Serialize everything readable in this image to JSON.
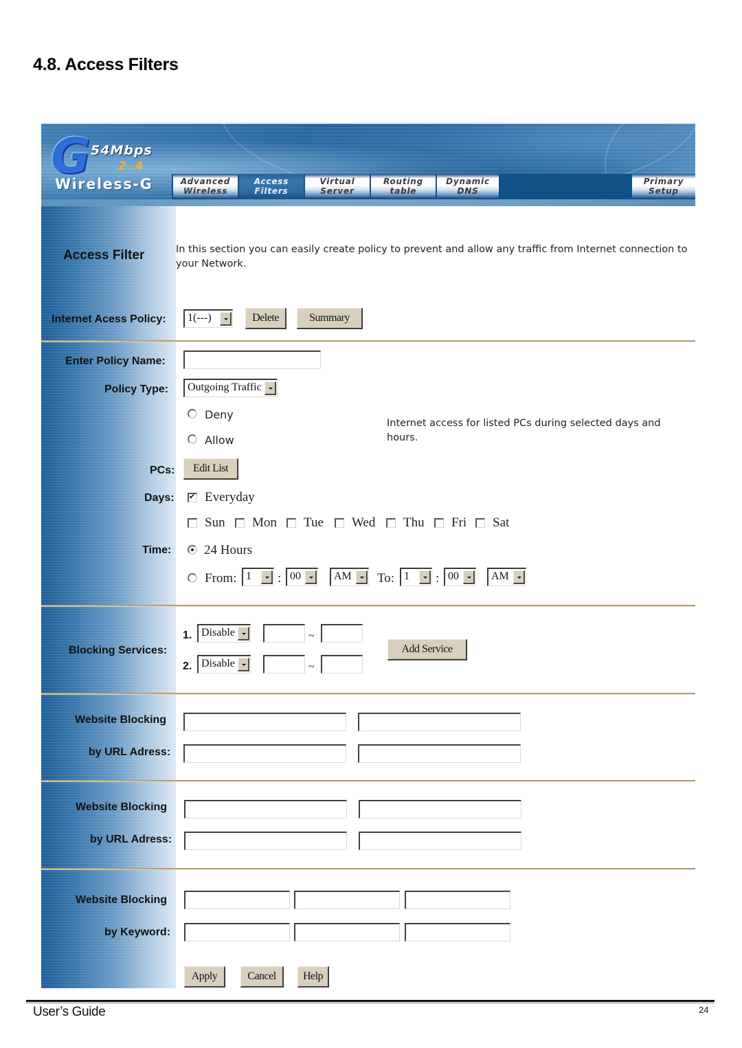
{
  "document": {
    "section_heading": "4.8. Access Filters",
    "footer_left": "User’s Guide",
    "page_number": "24"
  },
  "header": {
    "logo": {
      "letter": "G",
      "speed": "54Mbps",
      "band": "2.4",
      "brand": "Wireless-G",
      "accent_color": "#f4b02a"
    },
    "nav_tabs": [
      {
        "line1": "Advanced",
        "line2": "Wireless",
        "active": false
      },
      {
        "line1": "Access",
        "line2": "Filters",
        "active": true
      },
      {
        "line1": "Virtual",
        "line2": "Server",
        "active": false
      },
      {
        "line1": "Routing",
        "line2": "table",
        "active": false
      },
      {
        "line1": "Dynamic",
        "line2": "DNS",
        "active": false
      },
      {
        "line1": "Primary",
        "line2": "Setup",
        "active": false
      }
    ]
  },
  "intro": {
    "title": "Access Filter",
    "description": "In this section you can easily create policy to prevent and allow any traffic from Internet connection to your Network."
  },
  "policy": {
    "label": "Internet Acess Policy:",
    "selected": "1(---)",
    "delete_label": "Delete",
    "summary_label": "Summary"
  },
  "form": {
    "policy_name": {
      "label": "Enter Policy Name:",
      "value": ""
    },
    "policy_type": {
      "label": "Policy Type:",
      "selected": "Outgoing Traffic"
    },
    "action": {
      "options": [
        {
          "label": "Deny",
          "checked": false
        },
        {
          "label": "Allow",
          "checked": false
        }
      ],
      "hint": "Internet access for listed PCs during selected days and hours."
    },
    "pcs": {
      "label": "PCs:",
      "button": "Edit List"
    },
    "days": {
      "label": "Days:",
      "everyday": {
        "label": "Everyday",
        "checked": true
      },
      "items": [
        {
          "label": "Sun",
          "checked": false
        },
        {
          "label": "Mon",
          "checked": false
        },
        {
          "label": "Tue",
          "checked": false
        },
        {
          "label": "Wed",
          "checked": false
        },
        {
          "label": "Thu",
          "checked": false
        },
        {
          "label": "Fri",
          "checked": false
        },
        {
          "label": "Sat",
          "checked": false
        }
      ]
    },
    "time": {
      "label": "Time:",
      "all_day": {
        "label": "24 Hours",
        "checked": true
      },
      "range": {
        "checked": false,
        "from_label": "From:",
        "to_label": "To:",
        "colon": ":",
        "from_hour": "1",
        "from_minute": "00",
        "from_ampm": "AM",
        "to_hour": "1",
        "to_minute": "00",
        "to_ampm": "AM"
      }
    }
  },
  "blocking_services": {
    "label": "Blocking Services:",
    "rows": [
      {
        "index": "1.",
        "selected": "Disable",
        "port_from": "",
        "port_to": ""
      },
      {
        "index": "2.",
        "selected": "Disable",
        "port_from": "",
        "port_to": ""
      }
    ],
    "separator": "~",
    "add_label": "Add Service"
  },
  "url_blocking": [
    {
      "label_line1": "Website Blocking",
      "label_line2": "by URL Adress:",
      "values": [
        "",
        "",
        "",
        ""
      ]
    },
    {
      "label_line1": "Website Blocking",
      "label_line2": "by URL Adress:",
      "values": [
        "",
        "",
        "",
        ""
      ]
    }
  ],
  "keyword_blocking": {
    "label_line1": "Website Blocking",
    "label_line2": "by Keyword:",
    "values": [
      "",
      "",
      "",
      "",
      "",
      ""
    ]
  },
  "actions": {
    "apply": "Apply",
    "cancel": "Cancel",
    "help": "Help"
  }
}
